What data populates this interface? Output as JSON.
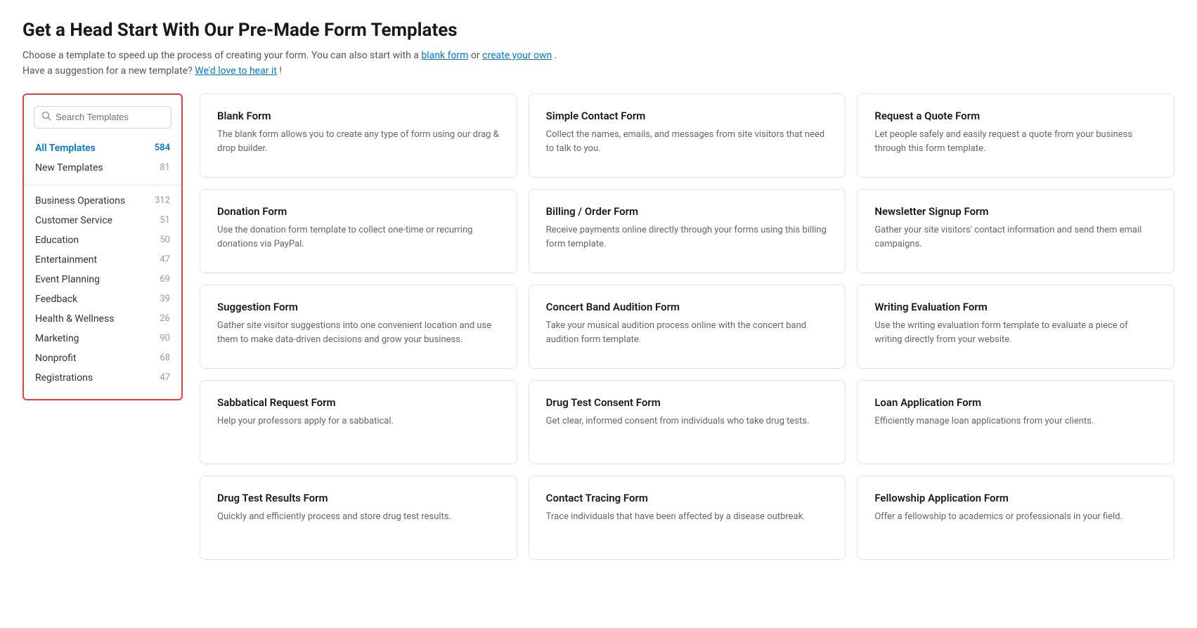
{
  "page": {
    "title": "Get a Head Start With Our Pre-Made Form Templates",
    "subtitle_1": "Choose a template to speed up the process of creating your form. You can also start with a",
    "link_blank": "blank form",
    "subtitle_2": "or",
    "link_create": "create your own",
    "subtitle_3": ".",
    "subtitle_4": "Have a suggestion for a new template?",
    "link_suggest": "We'd love to hear it",
    "subtitle_5": "!"
  },
  "sidebar": {
    "search_placeholder": "Search Templates",
    "items": [
      {
        "label": "All Templates",
        "count": "584",
        "active": true
      },
      {
        "label": "New Templates",
        "count": "81",
        "active": false
      }
    ],
    "categories": [
      {
        "label": "Business Operations",
        "count": "312"
      },
      {
        "label": "Customer Service",
        "count": "51"
      },
      {
        "label": "Education",
        "count": "50"
      },
      {
        "label": "Entertainment",
        "count": "47"
      },
      {
        "label": "Event Planning",
        "count": "69"
      },
      {
        "label": "Feedback",
        "count": "39"
      },
      {
        "label": "Health & Wellness",
        "count": "26"
      },
      {
        "label": "Marketing",
        "count": "90"
      },
      {
        "label": "Nonprofit",
        "count": "68"
      },
      {
        "label": "Registrations",
        "count": "47"
      }
    ]
  },
  "templates": [
    {
      "title": "Blank Form",
      "desc": "The blank form allows you to create any type of form using our drag & drop builder."
    },
    {
      "title": "Simple Contact Form",
      "desc": "Collect the names, emails, and messages from site visitors that need to talk to you."
    },
    {
      "title": "Request a Quote Form",
      "desc": "Let people safely and easily request a quote from your business through this form template."
    },
    {
      "title": "Donation Form",
      "desc": "Use the donation form template to collect one-time or recurring donations via PayPal."
    },
    {
      "title": "Billing / Order Form",
      "desc": "Receive payments online directly through your forms using this billing form template."
    },
    {
      "title": "Newsletter Signup Form",
      "desc": "Gather your site visitors' contact information and send them email campaigns."
    },
    {
      "title": "Suggestion Form",
      "desc": "Gather site visitor suggestions into one convenient location and use them to make data-driven decisions and grow your business."
    },
    {
      "title": "Concert Band Audition Form",
      "desc": "Take your musical audition process online with the concert band audition form template."
    },
    {
      "title": "Writing Evaluation Form",
      "desc": "Use the writing evaluation form template to evaluate a piece of writing directly from your website."
    },
    {
      "title": "Sabbatical Request Form",
      "desc": "Help your professors apply for a sabbatical."
    },
    {
      "title": "Drug Test Consent Form",
      "desc": "Get clear, informed consent from individuals who take drug tests."
    },
    {
      "title": "Loan Application Form",
      "desc": "Efficiently manage loan applications from your clients."
    },
    {
      "title": "Drug Test Results Form",
      "desc": "Quickly and efficiently process and store drug test results."
    },
    {
      "title": "Contact Tracing Form",
      "desc": "Trace individuals that have been affected by a disease outbreak."
    },
    {
      "title": "Fellowship Application Form",
      "desc": "Offer a fellowship to academics or professionals in your field."
    }
  ]
}
